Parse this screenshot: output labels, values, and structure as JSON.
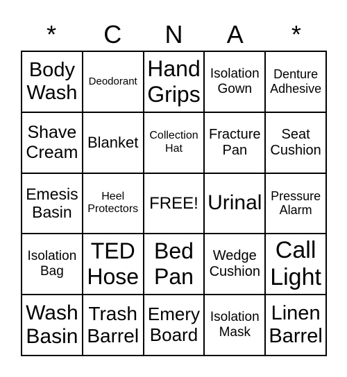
{
  "header": [
    "*",
    "C",
    "N",
    "A",
    "*"
  ],
  "cells": [
    "Body Wash",
    "Deodorant",
    "Hand Grips",
    "Isolation Gown",
    "Denture Adhesive",
    "Shave Cream",
    "Blanket",
    "Collection Hat",
    "Fracture Pan",
    "Seat Cushion",
    "Emesis Basin",
    "Heel Protectors",
    "FREE!",
    "Urinal",
    "Pressure Alarm",
    "Isolation Bag",
    "TED Hose",
    "Bed Pan",
    "Wedge Cushion",
    "Call Light",
    "Wash Basin",
    "Trash Barrel",
    "Emery Board",
    "Isolation Mask",
    "Linen Barrel"
  ]
}
